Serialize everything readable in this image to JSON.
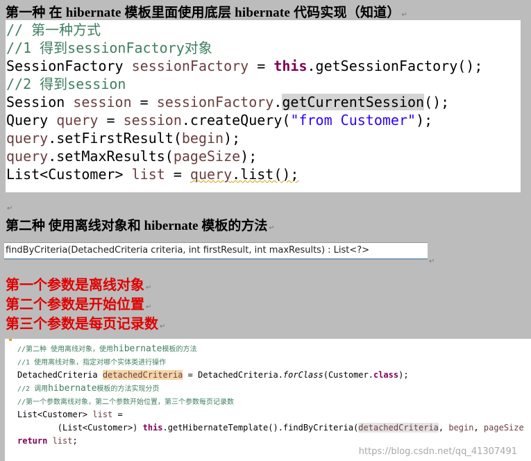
{
  "heading1": "第一种 在 hibernate 模板里面使用底层 hibernate 代码实现（知道）",
  "return_mark": "↵",
  "code1": {
    "l1": "// 第一种方式",
    "l2_c": "//1 得到",
    "l2_k": "sessionFactory",
    "l2_e": "对象",
    "l3_a": "SessionFactory ",
    "l3_v": "sessionFactory",
    "l3_eq": " = ",
    "l3_kw": "this",
    "l3_r": ".getSessionFactory();",
    "l4_c": "//2 得到",
    "l4_k": "session",
    "l5_a": "Session ",
    "l5_v": "session",
    "l5_eq": " = ",
    "l5_v2": "sessionFactory",
    "l5_dot": ".",
    "l5_m": "getCurrentSession",
    "l5_r": "();",
    "l6_a": "Query ",
    "l6_v": "query",
    "l6_eq": " = ",
    "l6_v2": "session",
    "l6_m": ".createQuery(",
    "l6_s": "\"from Customer\"",
    "l6_r": ");",
    "l7_v": "query",
    "l7_m": ".setFirstResult(",
    "l7_p": "begin",
    "l7_r": ");",
    "l8_v": "query",
    "l8_m": ".setMaxResults(",
    "l8_p": "pageSize",
    "l8_r": ");",
    "l9_a": "List<Customer> ",
    "l9_v": "list",
    "l9_eq": " = ",
    "l9_v2": "query",
    "l9_r": ".list();"
  },
  "heading2": "第二种 使用离线对象和 hibernate 模板的方法",
  "signature": "findByCriteria(DetachedCriteria criteria, int firstResult, int maxResults) : List<?>",
  "params": [
    "第一个参数是离线对象",
    "第二个参数是开始位置",
    "第三个参数是每页记录数"
  ],
  "code2": {
    "l1_c": "//第二种 使用离线对象，使用",
    "l1_k": "hibernate",
    "l1_e": "模板的方法",
    "l2": "//1 使用离线对象，指定对哪个实体类进行操作",
    "l3_a": "DetachedCriteria ",
    "l3_v": "detachedCriteria",
    "l3_b": " = DetachedCriteria.",
    "l3_i": "forClass",
    "l3_c": "(Customer.",
    "l3_kw": "class",
    "l3_r": ");",
    "l4_c": "//2 调用",
    "l4_k": "hibernate",
    "l4_e": "模板的方法实现分页",
    "l5": "//第一个参数离线对象，第二个参数开始位置，第三个参数每页记录数",
    "l6_a": "List<Customer> ",
    "l6_v": "list",
    "l6_r": " =",
    "l7_a": "        (List<Customer>) ",
    "l7_kw": "this",
    "l7_b": ".getHibernateTemplate().findByCriteria(",
    "l7_v": "detachedCriteria",
    "l7_c": ", ",
    "l7_p1": "begin",
    "l7_d": ", ",
    "l7_p2": "pageSize",
    "l8_kw": "return",
    "l8_v": " list",
    "l8_r": ";"
  },
  "watermark": "https://blog.csdn.net/qq_41307491"
}
